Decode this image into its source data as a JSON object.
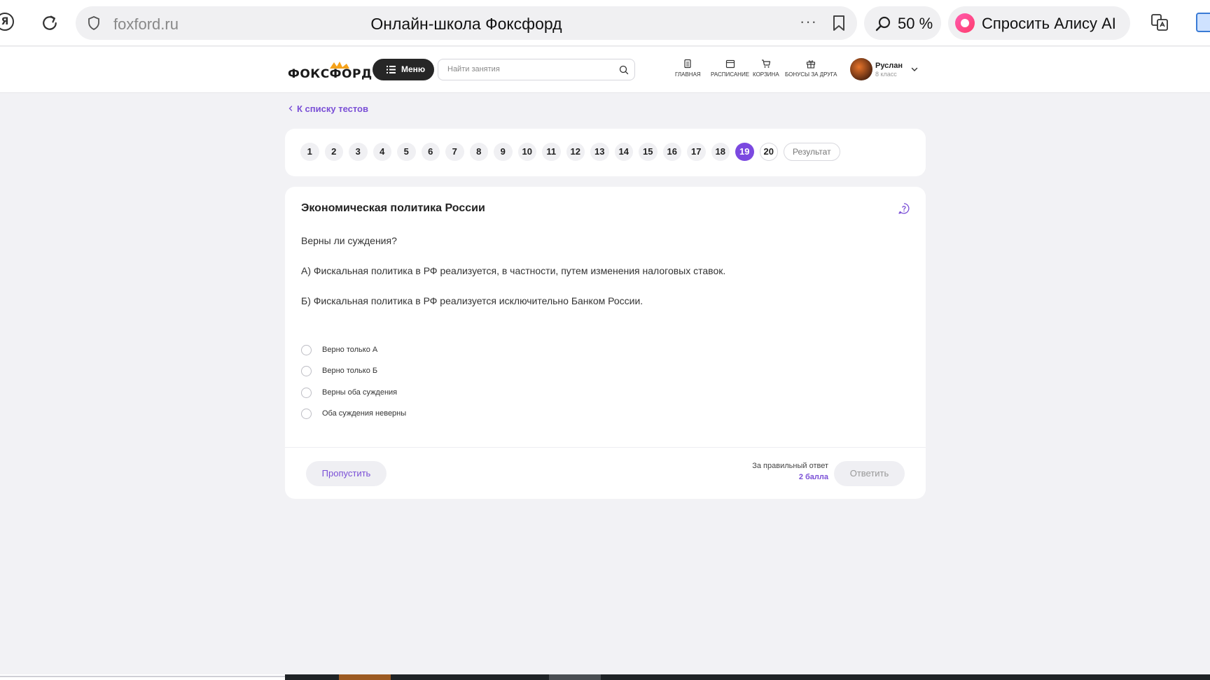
{
  "browser": {
    "url": "foxford.ru",
    "tab_title": "Онлайн-школа Фоксфорд",
    "zoom": "50 %",
    "alice_label": "Спросить Алису AI",
    "ya_glyph": "Я",
    "more_glyph": "···"
  },
  "header": {
    "logo_text": "ФОКСФОРД",
    "menu_label": "Меню",
    "search_placeholder": "Найти занятия",
    "nav": [
      {
        "label": "ГЛАВНАЯ",
        "icon": "home-icon"
      },
      {
        "label": "РАСПИСАНИЕ",
        "icon": "calendar-icon"
      },
      {
        "label": "КОРЗИНА",
        "icon": "cart-icon"
      },
      {
        "label": "БОНУСЫ ЗА ДРУГА",
        "icon": "gift-icon"
      }
    ],
    "user": {
      "name": "Руслан",
      "grade": "8 класс"
    }
  },
  "main": {
    "back_link": "К списку тестов",
    "pages": [
      "1",
      "2",
      "3",
      "4",
      "5",
      "6",
      "7",
      "8",
      "9",
      "10",
      "11",
      "12",
      "13",
      "14",
      "15",
      "16",
      "17",
      "18",
      "19",
      "20"
    ],
    "current_page": "19",
    "result_label": "Результат",
    "question": {
      "title": "Экономическая политика России",
      "prompt": "Верны ли суждения?",
      "statement_a": "А) Фискальная политика в РФ реализуется, в частности, путем изменения налоговых ставок.",
      "statement_b": "Б) Фискальная политика в РФ реализуется исключительно Банком России.",
      "options": [
        "Верно только А",
        "Верно только Б",
        "Верны оба суждения",
        "Оба суждения неверны"
      ]
    },
    "footer": {
      "skip_label": "Пропустить",
      "reward_label": "За правильный ответ",
      "reward_value": "2 балла",
      "answer_label": "Ответить"
    }
  },
  "colors": {
    "accent": "#7b49e0",
    "link": "#7a4fd6",
    "background": "#f2f2f5"
  }
}
